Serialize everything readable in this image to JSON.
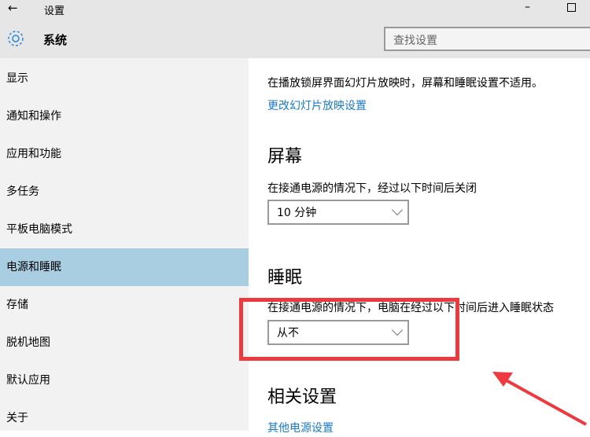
{
  "window": {
    "title": "设置",
    "back_icon": "arrow-left-icon"
  },
  "header": {
    "title": "系统",
    "search_placeholder": "查找设置"
  },
  "sidebar": {
    "items": [
      {
        "label": "显示"
      },
      {
        "label": "通知和操作"
      },
      {
        "label": "应用和功能"
      },
      {
        "label": "多任务"
      },
      {
        "label": "平板电脑模式"
      },
      {
        "label": "电源和睡眠",
        "selected": true
      },
      {
        "label": "存储"
      },
      {
        "label": "脱机地图"
      },
      {
        "label": "默认应用"
      },
      {
        "label": "关于"
      }
    ]
  },
  "content": {
    "slideshow_note": "在播放锁屏界面幻灯片放映时，屏幕和睡眠设置不适用。",
    "slideshow_link": "更改幻灯片放映设置",
    "screen": {
      "heading": "屏幕",
      "label": "在接通电源的情况下，经过以下时间后关闭",
      "value": "10 分钟"
    },
    "sleep": {
      "heading": "睡眠",
      "label": "在接通电源的情况下，电脑在经过以下时间后进入睡眠状态",
      "value": "从不"
    },
    "related": {
      "heading": "相关设置",
      "link": "其他电源设置"
    }
  },
  "colors": {
    "accent": "#1979ca",
    "selected": "#a9cde1",
    "annotation": "#ee3a3f"
  }
}
